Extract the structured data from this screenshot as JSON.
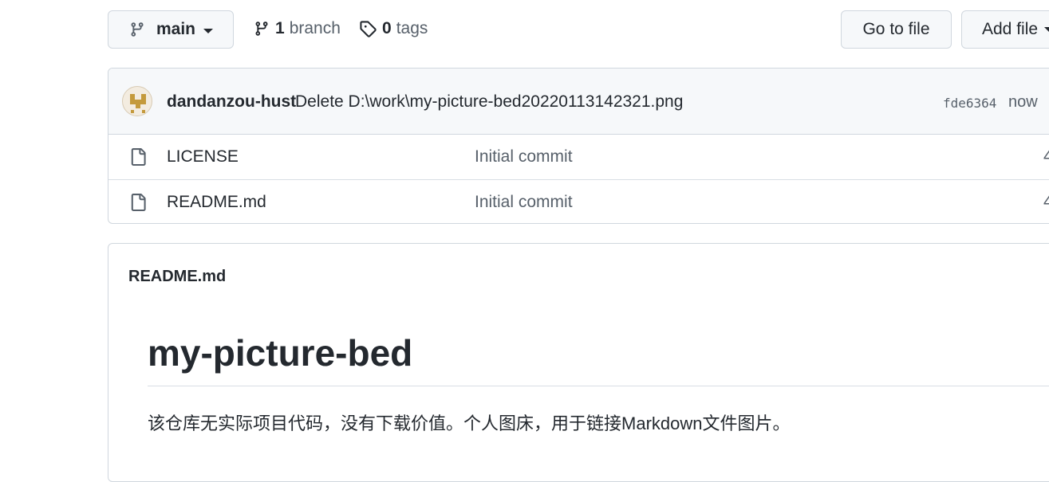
{
  "toolbar": {
    "branch_selector": "main",
    "branches_count": "1",
    "branches_label": "branch",
    "tags_count": "0",
    "tags_label": "tags",
    "go_to_file": "Go to file",
    "add_file": "Add file"
  },
  "latest_commit": {
    "author": "dandanzou-hust",
    "message": "Delete D:\\work\\my-picture-bed20220113142321.png",
    "hash": "fde6364",
    "time": "now"
  },
  "files": [
    {
      "icon": "file-icon",
      "name": "LICENSE",
      "message": "Initial commit",
      "age": "4"
    },
    {
      "icon": "file-icon",
      "name": "README.md",
      "message": "Initial commit",
      "age": "4"
    }
  ],
  "readme": {
    "filename": "README.md",
    "heading": "my-picture-bed",
    "description": "该仓库无实际项目代码，没有下载价值。个人图床，用于链接Markdown文件图片。"
  }
}
